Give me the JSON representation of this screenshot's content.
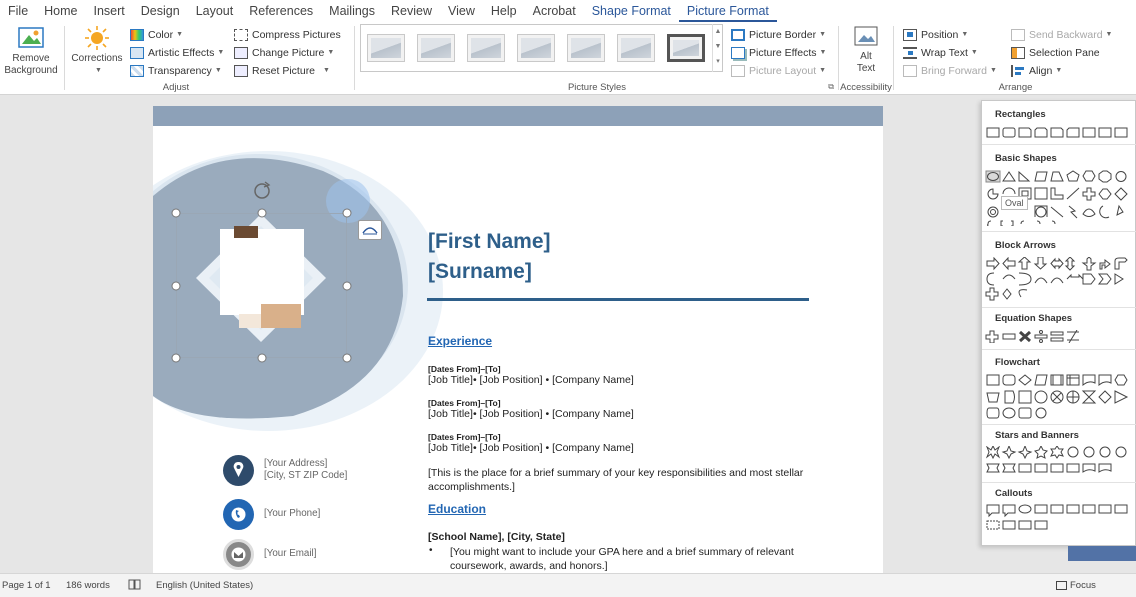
{
  "menu": {
    "tabs": [
      {
        "label": "File"
      },
      {
        "label": "Home"
      },
      {
        "label": "Insert"
      },
      {
        "label": "Design"
      },
      {
        "label": "Layout"
      },
      {
        "label": "References"
      },
      {
        "label": "Mailings"
      },
      {
        "label": "Review"
      },
      {
        "label": "View"
      },
      {
        "label": "Help"
      },
      {
        "label": "Acrobat"
      },
      {
        "label": "Shape Format"
      },
      {
        "label": "Picture Format"
      }
    ],
    "active_tab": "Picture Format"
  },
  "ribbon": {
    "remove_bg_line1": "Remove",
    "remove_bg_line2": "Background",
    "corrections": "Corrections",
    "color": "Color",
    "artistic_effects": "Artistic Effects",
    "transparency": "Transparency",
    "compress": "Compress Pictures",
    "change": "Change Picture",
    "reset": "Reset Picture",
    "adjust_label": "Adjust",
    "picture_styles_label": "Picture Styles",
    "picture_border": "Picture Border",
    "picture_effects": "Picture Effects",
    "picture_layout": "Picture Layout",
    "alt_line1": "Alt",
    "alt_line2": "Text",
    "accessibility_label": "Accessibility",
    "position": "Position",
    "wrap_text": "Wrap Text",
    "bring_forward": "Bring Forward",
    "send_backward": "Send Backward",
    "selection_pane": "Selection Pane",
    "align": "Align",
    "arrange_label": "Arrange"
  },
  "document": {
    "first_name": "[First Name]",
    "surname": "[Surname]",
    "experience_heading": "Experience",
    "jobs": [
      {
        "dates": "[Dates From]–[To]",
        "line": "[Job Title]• [Job Position] • [Company Name]"
      },
      {
        "dates": "[Dates From]–[To]",
        "line": "[Job Title]• [Job Position] • [Company Name]"
      },
      {
        "dates": "[Dates From]–[To]",
        "line": "[Job Title]• [Job Position] • [Company Name]"
      }
    ],
    "summary": "[This is the place for a brief summary of your key responsibilities and most stellar accomplishments.]",
    "education_heading": "Education",
    "school": "[School Name], [City, State]",
    "edu_bullet": "[You might want to include your GPA here and a brief summary of relevant coursework, awards, and honors.]",
    "address_line1": "[Your Address]",
    "address_line2": "[City, ST ZIP Code]",
    "phone": "[Your Phone]",
    "email": "[Your Email]"
  },
  "shapes_panel": {
    "sections": [
      {
        "title": "Rectangles"
      },
      {
        "title": "Basic Shapes"
      },
      {
        "title": "Block Arrows"
      },
      {
        "title": "Equation Shapes"
      },
      {
        "title": "Flowchart"
      },
      {
        "title": "Stars and Banners"
      },
      {
        "title": "Callouts"
      }
    ],
    "tooltip": "Oval"
  },
  "status": {
    "page": "Page 1 of 1",
    "words": "186 words",
    "language": "English (United States)",
    "focus": "Focus"
  },
  "colors": {
    "accent": "#2b579a",
    "name_blue": "#2e5f8a",
    "link_blue": "#2266b3",
    "band": "#8da1b8",
    "brush": "#9aabbd",
    "icon_blue": "#2266b3",
    "icon_navy": "#2e4b6b"
  }
}
